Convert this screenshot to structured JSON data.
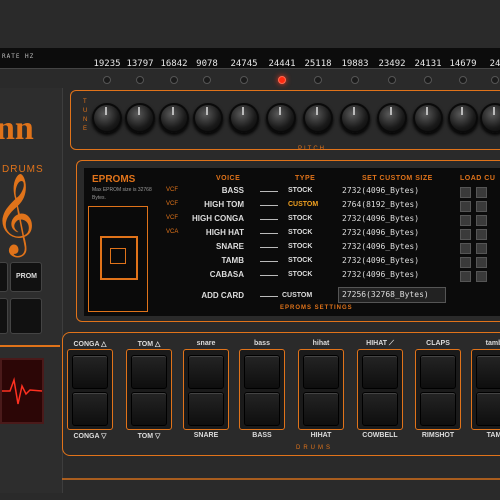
{
  "header": {
    "rate_label": "RATE HZ",
    "rates": [
      "19235",
      "13797",
      "16842",
      "9078",
      "24745",
      "24441",
      "25118",
      "19883",
      "23492",
      "24131",
      "14679",
      "24"
    ]
  },
  "brand": {
    "name": "nn",
    "subtitle": "DRUMS",
    "prom_label": "PROM"
  },
  "tune": {
    "label": "TUNE",
    "pitch_label": "PITCH"
  },
  "eproms": {
    "title": "EPROMS",
    "note": "Max EPROM size is 32768 Bytes.",
    "headers": {
      "voice": "VOICE",
      "type": "TYPE",
      "size": "SET CUSTOM SIZE",
      "load": "LOAD CU"
    },
    "rows": [
      {
        "tag": "VCF",
        "voice": "BASS",
        "type": "STOCK",
        "size": "2732(4096_Bytes)"
      },
      {
        "tag": "VCF",
        "voice": "HIGH TOM",
        "type": "CUSTOM",
        "size": "2764(8192_Bytes)"
      },
      {
        "tag": "VCF",
        "voice": "HIGH CONGA",
        "type": "STOCK",
        "size": "2732(4096_Bytes)"
      },
      {
        "tag": "VCA",
        "voice": "HIGH HAT",
        "type": "STOCK",
        "size": "2732(4096_Bytes)"
      },
      {
        "tag": "",
        "voice": "SNARE",
        "type": "STOCK",
        "size": "2732(4096_Bytes)"
      },
      {
        "tag": "",
        "voice": "TAMB",
        "type": "STOCK",
        "size": "2732(4096_Bytes)"
      },
      {
        "tag": "",
        "voice": "CABASA",
        "type": "STOCK",
        "size": "2732(4096_Bytes)"
      }
    ],
    "add_card": {
      "voice": "ADD CARD",
      "type": "CUSTOM",
      "size": "27256(32768_Bytes)"
    },
    "settings_label": "EPROMS SETTINGS"
  },
  "drums": {
    "label": "DRUMS",
    "pads": [
      {
        "top": "CONGA △",
        "bottom": "CONGA ▽"
      },
      {
        "top": "TOM △",
        "bottom": "TOM ▽"
      },
      {
        "top": "snare",
        "bottom": "SNARE"
      },
      {
        "top": "bass",
        "bottom": "BASS"
      },
      {
        "top": "hihat",
        "bottom": "HIHAT"
      },
      {
        "top": "HIHAT ⟋",
        "bottom": "COWBELL"
      },
      {
        "top": "CLAPS",
        "bottom": "RIMSHOT"
      },
      {
        "top": "tamb",
        "bottom": "TAM"
      }
    ]
  },
  "colors": {
    "accent": "#e0731a",
    "led_on": "#ff2a10",
    "background": "#2a2a2a"
  }
}
